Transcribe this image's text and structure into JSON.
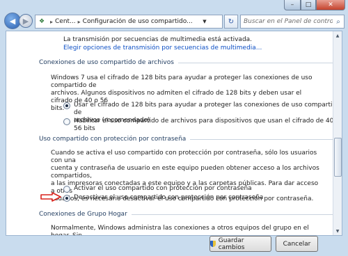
{
  "window": {
    "controls": {
      "min": "–",
      "max": "□",
      "close": "✕"
    }
  },
  "nav": {
    "back_icon": "back-arrow-icon",
    "forward_icon": "forward-arrow-icon",
    "address": {
      "crumb1": "Cent...",
      "separator": "▸",
      "crumb2": "Configuración de uso compartido..."
    },
    "refresh_icon": "refresh-icon",
    "search_placeholder": "Buscar en el Panel de control"
  },
  "content": {
    "top_line1": "La transmisión por secuencias de multimedia está activada.",
    "top_link": "Elegir opciones de transmisión por secuencias de multimedia...",
    "sections": [
      {
        "title": "Conexiones de uso compartido de archivos",
        "paragraph": "Windows 7 usa el cifrado de 128 bits para ayudar a proteger las conexiones de uso compartido de archivos. Algunos dispositivos no admiten el cifrado de 128 bits y deben usar el cifrado de 40 o 56 bits.",
        "para_lines": [
          "Windows 7 usa el cifrado de 128 bits para ayudar a proteger las conexiones de uso compartido de",
          "archivos. Algunos dispositivos no admiten el cifrado de 128 bits y deben usar el cifrado de 40 o 56",
          "bits."
        ],
        "options": [
          {
            "label_lines": [
              "Usar el cifrado de 128 bits para ayudar a proteger las conexiones de uso compartido de",
              "archivos (recomendado)"
            ],
            "selected": true
          },
          {
            "label_lines": [
              "Habilitar el uso compartido de archivos para dispositivos que usan el cifrado de 40 o 56 bits"
            ],
            "selected": false
          }
        ]
      },
      {
        "title": "Uso compartido con protección por contraseña",
        "para_lines": [
          "Cuando se activa el uso compartido con protección por contraseña, sólo los usuarios con una",
          "cuenta y contraseña de usuario en este equipo pueden obtener acceso a los archivos compartidos,",
          "a las impresoras conectadas a este equipo y a las carpetas públicas. Para dar acceso a otros",
          "usuarios, es necesario desactivar el uso compartido con protección por contraseña."
        ],
        "options": [
          {
            "label_lines": [
              "Activar el uso compartido con protección por contraseña"
            ],
            "selected": false
          },
          {
            "label_lines": [
              "Desactivar el uso compartido con protección por contraseña"
            ],
            "selected": true
          }
        ]
      },
      {
        "title": "Conexiones de Grupo Hogar",
        "para_lines": [
          "Normalmente, Windows administra las conexiones a otros equipos del grupo en el hogar. Sin"
        ]
      }
    ]
  },
  "footer": {
    "save_label": "Guardar cambios",
    "save_icon": "uac-shield-icon",
    "cancel_label": "Cancelar"
  },
  "colors": {
    "link": "#0b4ec4",
    "annotation_arrow": "#d9221c",
    "frame": "#c9dcee"
  }
}
